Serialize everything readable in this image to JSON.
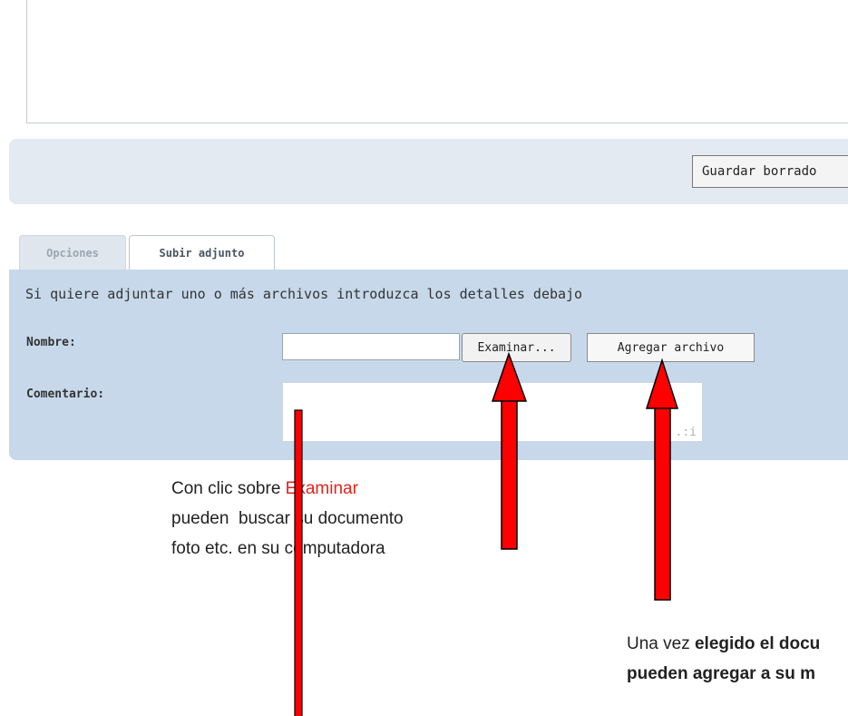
{
  "draft": {
    "save_label": "Guardar borrado"
  },
  "tabs": [
    {
      "label": "Opciones",
      "active": false
    },
    {
      "label": "Subir adjunto",
      "active": true
    }
  ],
  "attach": {
    "intro": "Si quiere adjuntar uno o más archivos introduzca los detalles debajo",
    "name_label": "Nombre:",
    "name_value": "",
    "browse_label": "Examinar...",
    "add_label": "Agregar archivo",
    "comment_label": "Comentario:",
    "comment_value": ""
  },
  "annotations": {
    "browse_note": {
      "line1_prefix": "Con clic sobre ",
      "line1_highlight": "Examinar",
      "line2": "pueden  buscar su documento",
      "line3": "foto etc. en su computadora"
    },
    "add_note": {
      "line1_prefix": "Una vez ",
      "line1_bold": "elegido el docu",
      "line2_bold": "pueden agregar a su m"
    }
  },
  "colors": {
    "panel_bg": "#c7d8ea",
    "draft_bar_bg": "#e3eaf1",
    "arrow_fill": "#ff0000",
    "highlight_text": "#e3231c"
  },
  "icons": {
    "resize_grip": "resize-grip-icon",
    "arrow": "up-arrow-icon"
  }
}
